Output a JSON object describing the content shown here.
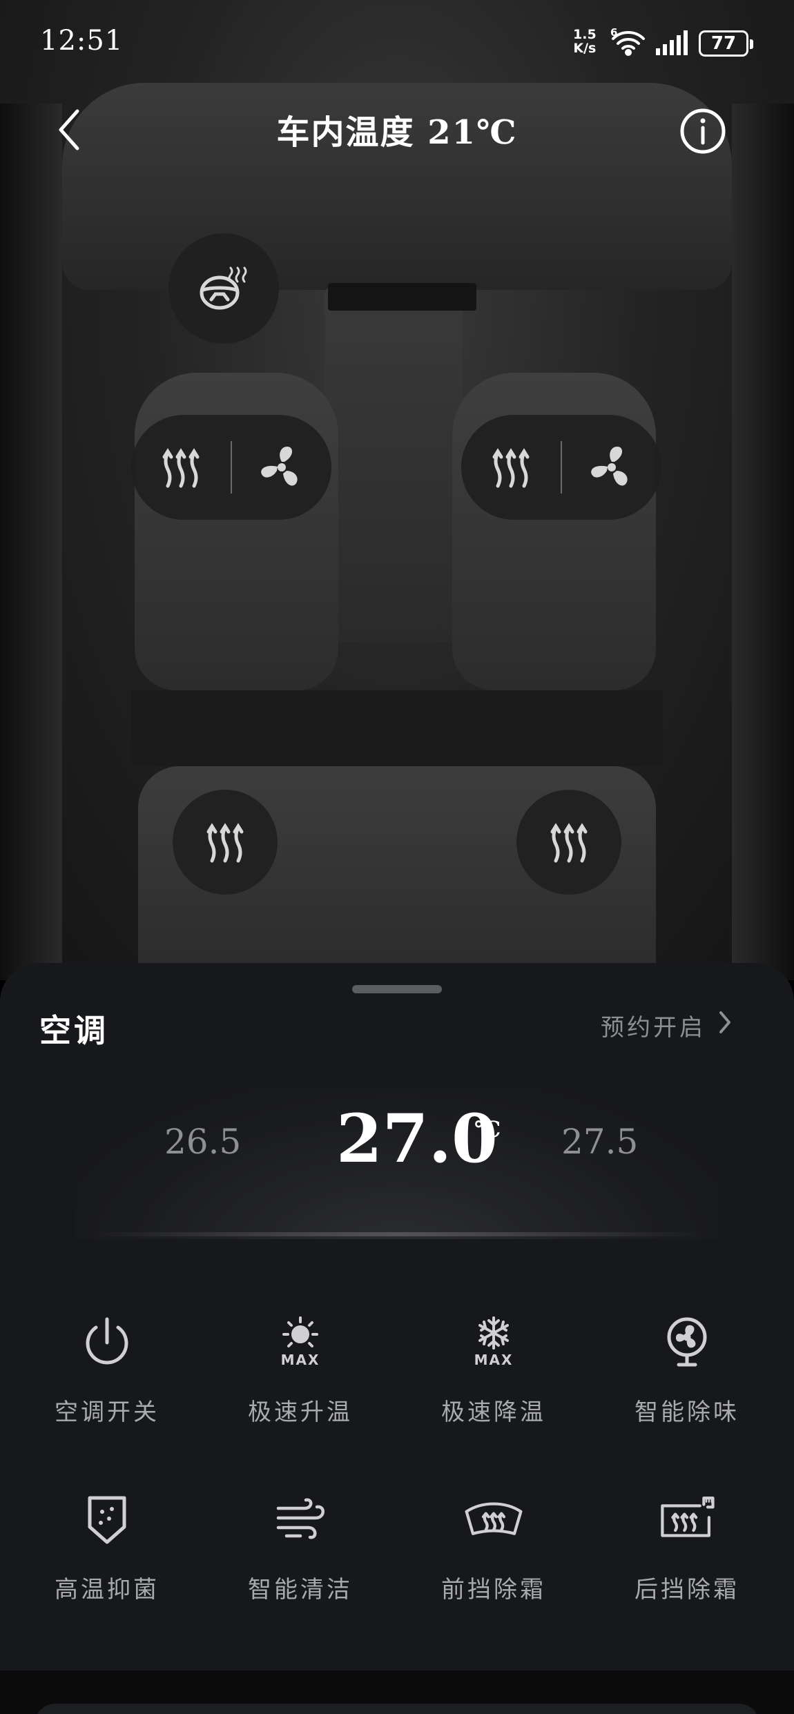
{
  "status_bar": {
    "time": "12:51",
    "net_speed_value": "1.5",
    "net_speed_unit": "K/s",
    "wifi_badge": "6",
    "battery": "77",
    "icons": [
      "wifi-icon",
      "signal-icon",
      "battery-icon"
    ]
  },
  "header": {
    "title": "车内温度 21℃",
    "back_icon": "chevron-left-icon",
    "info_icon": "info-icon"
  },
  "car_controls": {
    "steering_wheel_heat_icon": "steering-wheel-heat-icon",
    "front_left": [
      "seat-heat-icon",
      "seat-ventilation-icon"
    ],
    "front_right": [
      "seat-heat-icon",
      "seat-ventilation-icon"
    ],
    "rear_left": "seat-heat-icon",
    "rear_right": "seat-heat-icon"
  },
  "panel": {
    "title": "空调",
    "schedule_label": "预约开启",
    "temperature": {
      "prev": "26.5",
      "current": "27.0",
      "next": "27.5",
      "unit": "℃"
    },
    "functions_row1": [
      {
        "label": "空调开关",
        "icon": "power-icon"
      },
      {
        "label": "极速升温",
        "icon": "sun-max-icon",
        "badge": "MAX"
      },
      {
        "label": "极速降温",
        "icon": "snowflake-max-icon",
        "badge": "MAX"
      },
      {
        "label": "智能除味",
        "icon": "fan-icon"
      }
    ],
    "functions_row2": [
      {
        "label": "高温抑菌",
        "icon": "shield-icon"
      },
      {
        "label": "智能清洁",
        "icon": "wind-icon"
      },
      {
        "label": "前挡除霜",
        "icon": "front-defrost-icon"
      },
      {
        "label": "后挡除霜",
        "icon": "rear-defrost-icon"
      }
    ]
  },
  "colors": {
    "panel_bg": "#17181b",
    "label_gray": "#a9aaae",
    "secondary_gray": "#8e8f93"
  }
}
